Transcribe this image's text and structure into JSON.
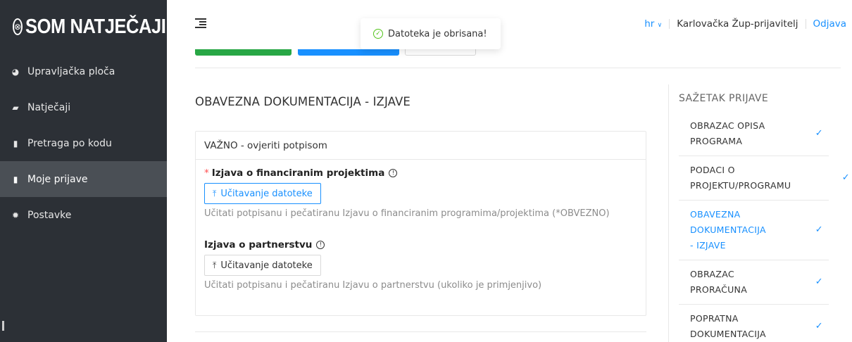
{
  "brand": {
    "name": "SOM NATJEČAJI"
  },
  "sidebar": {
    "items": [
      {
        "label": "Upravljačka ploča",
        "icon": "pie-chart-icon"
      },
      {
        "label": "Natječaji",
        "icon": "folder-icon"
      },
      {
        "label": "Pretraga po kodu",
        "icon": "file-icon"
      },
      {
        "label": "Moje prijave",
        "icon": "file-text-icon",
        "active": true
      },
      {
        "label": "Postavke",
        "icon": "gear-icon"
      }
    ]
  },
  "header": {
    "language": "hr",
    "user": "Karlovačka Žup-prijavitelj",
    "logout": "Odjava"
  },
  "toast": {
    "message": "Datoteka je obrisana!"
  },
  "main": {
    "title": "OBAVEZNA DOKUMENTACIJA - IZJAVE",
    "card": {
      "heading": "VAŽNO - ovjeriti potpisom",
      "fields": [
        {
          "label": "Izjava o financiranim projektima",
          "required": true,
          "button": "Učitavanje datoteke",
          "hint": "Učitati potpisanu i pečatiranu Izjavu o financiranim programima/projektima (*OBVEZNO)"
        },
        {
          "label": "Izjava o partnerstvu",
          "required": false,
          "button": "Učitavanje datoteke",
          "hint": "Učitati potpisanu i pečatiranu Izjavu o partnerstvu (ukoliko je primjenjivo)"
        }
      ]
    }
  },
  "summary": {
    "title": "SAŽETAK PRIJAVE",
    "items": [
      {
        "line1": "OBRAZAC OPISA",
        "line2": "PROGRAMA",
        "line3": ""
      },
      {
        "line1": "PODACI O",
        "line2": "PROJEKTU/PROGRAMU",
        "line3": ""
      },
      {
        "line1": "OBAVEZNA",
        "line2": "DOKUMENTACIJA",
        "line3": "- IZJAVE",
        "active": true
      },
      {
        "line1": "OBRAZAC",
        "line2": "PRORAČUNA",
        "line3": ""
      },
      {
        "line1": "POPRATNA",
        "line2": "DOKUMENTACIJA",
        "line3": ""
      }
    ]
  },
  "colors": {
    "accent": "#1890ff",
    "success": "#28a745",
    "sidebar": "#2c3036",
    "required": "#ff4d4f"
  }
}
